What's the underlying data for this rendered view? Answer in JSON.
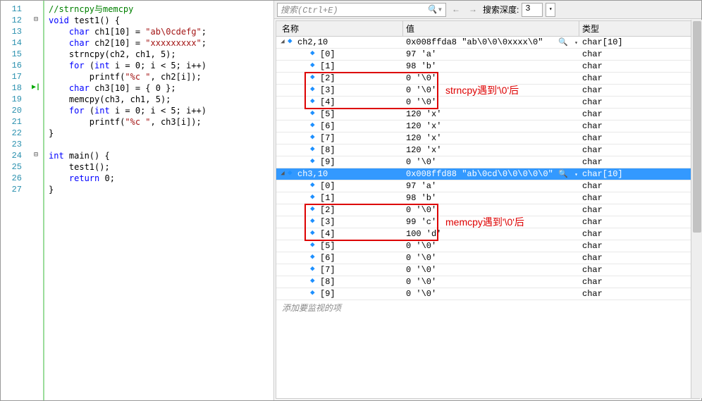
{
  "code": {
    "start": 11,
    "lines": [
      {
        "n": 11,
        "html": "<span class='cmt'>//strncpy与memcpy</span>",
        "marker": ""
      },
      {
        "n": 12,
        "html": "<span class='kw'>void</span> test1() {",
        "marker": "minus"
      },
      {
        "n": 13,
        "html": "    <span class='kw'>char</span> ch1[10] = <span class='str'>\"ab\\0cdefg\"</span>;",
        "marker": ""
      },
      {
        "n": 14,
        "html": "    <span class='kw'>char</span> ch2[10] = <span class='str'>\"xxxxxxxxx\"</span>;",
        "marker": ""
      },
      {
        "n": 15,
        "html": "    strncpy(ch2, ch1, 5);",
        "marker": ""
      },
      {
        "n": 16,
        "html": "    <span class='kw'>for</span> (<span class='kw'>int</span> i = 0; i &lt; 5; i++)",
        "marker": ""
      },
      {
        "n": 17,
        "html": "        printf(<span class='str'>\"%c \"</span>, ch2[i]);",
        "marker": ""
      },
      {
        "n": 18,
        "html": "    <span class='kw'>char</span> ch3[10] = { 0 };",
        "marker": "arrow"
      },
      {
        "n": 19,
        "html": "    memcpy(ch3, ch1, 5);",
        "marker": ""
      },
      {
        "n": 20,
        "html": "    <span class='kw'>for</span> (<span class='kw'>int</span> i = 0; i &lt; 5; i++)",
        "marker": ""
      },
      {
        "n": 21,
        "html": "        printf(<span class='str'>\"%c \"</span>, ch3[i]);",
        "marker": ""
      },
      {
        "n": 22,
        "html": "}",
        "marker": ""
      },
      {
        "n": 23,
        "html": "",
        "marker": ""
      },
      {
        "n": 24,
        "html": "<span class='kw'>int</span> main() {",
        "marker": "minus"
      },
      {
        "n": 25,
        "html": "    test1();",
        "marker": ""
      },
      {
        "n": 26,
        "html": "    <span class='kw'>return</span> 0;",
        "marker": ""
      },
      {
        "n": 27,
        "html": "}",
        "marker": ""
      }
    ]
  },
  "toolbar": {
    "search_placeholder": "搜索(Ctrl+E)",
    "depth_label": "搜索深度:",
    "depth_value": "3"
  },
  "columns": {
    "name": "名称",
    "value": "值",
    "type": "类型"
  },
  "rows": [
    {
      "indent": 0,
      "exp": "▿",
      "name": "ch2,10",
      "value": "0x008ffda8 \"ab\\0\\0\\0xxxx\\0\"",
      "type": "char[10]",
      "mag": true
    },
    {
      "indent": 1,
      "name": "[0]",
      "value": "97 'a'",
      "type": "char"
    },
    {
      "indent": 1,
      "name": "[1]",
      "value": "98 'b'",
      "type": "char"
    },
    {
      "indent": 1,
      "name": "[2]",
      "value": "0 '\\0'",
      "type": "char"
    },
    {
      "indent": 1,
      "name": "[3]",
      "value": "0 '\\0'",
      "type": "char"
    },
    {
      "indent": 1,
      "name": "[4]",
      "value": "0 '\\0'",
      "type": "char"
    },
    {
      "indent": 1,
      "name": "[5]",
      "value": "120 'x'",
      "type": "char"
    },
    {
      "indent": 1,
      "name": "[6]",
      "value": "120 'x'",
      "type": "char"
    },
    {
      "indent": 1,
      "name": "[7]",
      "value": "120 'x'",
      "type": "char"
    },
    {
      "indent": 1,
      "name": "[8]",
      "value": "120 'x'",
      "type": "char"
    },
    {
      "indent": 1,
      "name": "[9]",
      "value": "0 '\\0'",
      "type": "char"
    },
    {
      "indent": 0,
      "exp": "▿",
      "name": "ch3,10",
      "value": "0x008ffd88 \"ab\\0cd\\0\\0\\0\\0\\0\"",
      "type": "char[10]",
      "mag": true,
      "sel": true
    },
    {
      "indent": 1,
      "name": "[0]",
      "value": "97 'a'",
      "type": "char"
    },
    {
      "indent": 1,
      "name": "[1]",
      "value": "98 'b'",
      "type": "char"
    },
    {
      "indent": 1,
      "name": "[2]",
      "value": "0 '\\0'",
      "type": "char"
    },
    {
      "indent": 1,
      "name": "[3]",
      "value": "99 'c'",
      "type": "char"
    },
    {
      "indent": 1,
      "name": "[4]",
      "value": "100 'd'",
      "type": "char"
    },
    {
      "indent": 1,
      "name": "[5]",
      "value": "0 '\\0'",
      "type": "char"
    },
    {
      "indent": 1,
      "name": "[6]",
      "value": "0 '\\0'",
      "type": "char"
    },
    {
      "indent": 1,
      "name": "[7]",
      "value": "0 '\\0'",
      "type": "char"
    },
    {
      "indent": 1,
      "name": "[8]",
      "value": "0 '\\0'",
      "type": "char"
    },
    {
      "indent": 1,
      "name": "[9]",
      "value": "0 '\\0'",
      "type": "char"
    }
  ],
  "placeholder_row": "添加要监视的项",
  "annotations": {
    "a1": "strncpy遇到'\\0'后",
    "a2": "memcpy遇到'\\0'后"
  }
}
